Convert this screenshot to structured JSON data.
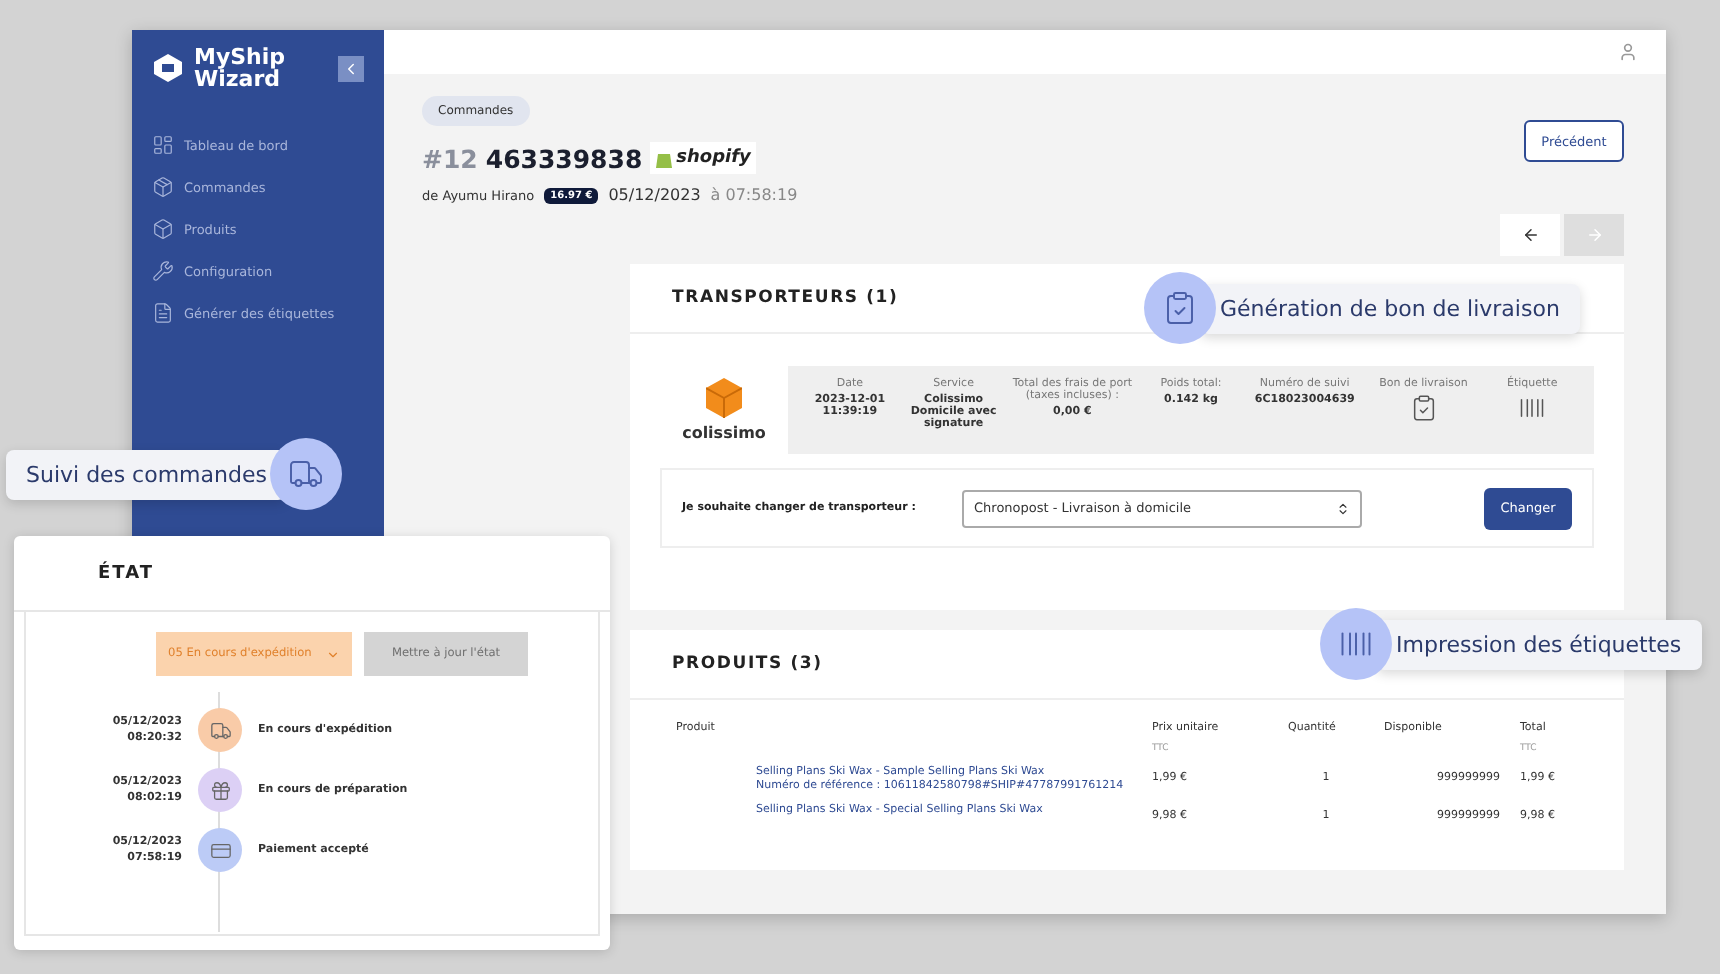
{
  "sidebar": {
    "logo": [
      "MyShip",
      "Wizard"
    ],
    "items": [
      {
        "label": "Tableau de bord"
      },
      {
        "label": "Commandes"
      },
      {
        "label": "Produits"
      },
      {
        "label": "Configuration"
      },
      {
        "label": "Générer des étiquettes"
      }
    ]
  },
  "breadcrumb": "Commandes",
  "back_button": "Précédent",
  "order": {
    "prefix": "#12",
    "number": "463339838",
    "platform": "shopify",
    "customer": "de Ayumu Hirano",
    "amount": "16.97 €",
    "date": "05/12/2023",
    "at": "à",
    "time": "07:58:19"
  },
  "nav_buttons": [
    {
      "disabled": false
    },
    {
      "disabled": true
    }
  ],
  "carriers": {
    "title": "TRANSPORTEURS (1)",
    "carrier": "colissimo",
    "fields": [
      {
        "kind": "text",
        "label": "Date",
        "value": "2023-12-01 11:39:19"
      },
      {
        "kind": "text",
        "label": "Service",
        "value": "Colissimo Domicile avec signature"
      },
      {
        "kind": "text",
        "label": "Total des frais de port (taxes incluses) :",
        "value": "0,00 €"
      },
      {
        "kind": "text",
        "label": "Poids total:",
        "value": "0.142 kg"
      },
      {
        "kind": "text",
        "label": "Numéro de suivi",
        "value": "6C18023004639"
      },
      {
        "kind": "icon",
        "label": "Bon de livraison"
      },
      {
        "kind": "icon",
        "label": "Étiquette"
      }
    ],
    "change_label": "Je souhaite changer de transporteur :",
    "change_value": "Chronopost - Livraison à domicile",
    "change_button": "Changer"
  },
  "products": {
    "title": "PRODUITS (3)",
    "columns": [
      {
        "label": "Produit"
      },
      {
        "label": "Prix unitaire",
        "sub": "TTC"
      },
      {
        "label": "Quantité"
      },
      {
        "label": "Disponible"
      },
      {
        "label": "Total",
        "sub": "TTC"
      }
    ],
    "rows": [
      {
        "name": "Selling Plans Ski Wax - Sample Selling Plans Ski Wax",
        "reference": "Numéro de référence : 10611842580798#SHIP#47787991761214",
        "price": "1,99 €",
        "quantity": "1",
        "available": "999999999",
        "total": "1,99 €"
      },
      {
        "name": "Selling Plans Ski Wax - Special Selling Plans Ski Wax",
        "price": "9,98 €",
        "quantity": "1",
        "available": "999999999",
        "total": "9,98 €"
      }
    ]
  },
  "status": {
    "title": "ÉTAT",
    "select": "05 En cours d'expédition",
    "update_button": "Mettre à jour l'état",
    "update_disabled": true,
    "timeline": [
      {
        "date": "05/12/2023",
        "time": "08:20:32",
        "label": "En cours d'expédition",
        "color": "#f9cba8"
      },
      {
        "date": "05/12/2023",
        "time": "08:02:19",
        "label": "En cours de préparation",
        "color": "#dcd0f5"
      },
      {
        "date": "05/12/2023",
        "time": "07:58:19",
        "label": "Paiement accepté",
        "color": "#bccbf6"
      }
    ]
  },
  "callouts": [
    {
      "label": "Suivi des commandes"
    },
    {
      "label": "Génération de bon de livraison"
    },
    {
      "label": "Impression des étiquettes"
    }
  ]
}
